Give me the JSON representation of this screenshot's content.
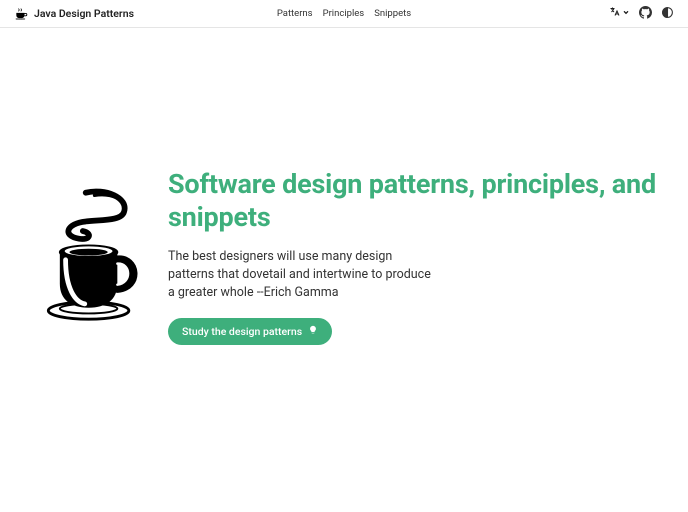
{
  "brand": {
    "name": "Java Design Patterns"
  },
  "nav": {
    "items": [
      {
        "label": "Patterns"
      },
      {
        "label": "Principles"
      },
      {
        "label": "Snippets"
      }
    ]
  },
  "hero": {
    "title": "Software design patterns, principles, and snippets",
    "description": "The best designers will use many design patterns that dovetail and intertwine to produce a greater whole --Erich Gamma",
    "cta_label": "Study the design patterns"
  },
  "colors": {
    "accent": "#3eaf7c"
  }
}
